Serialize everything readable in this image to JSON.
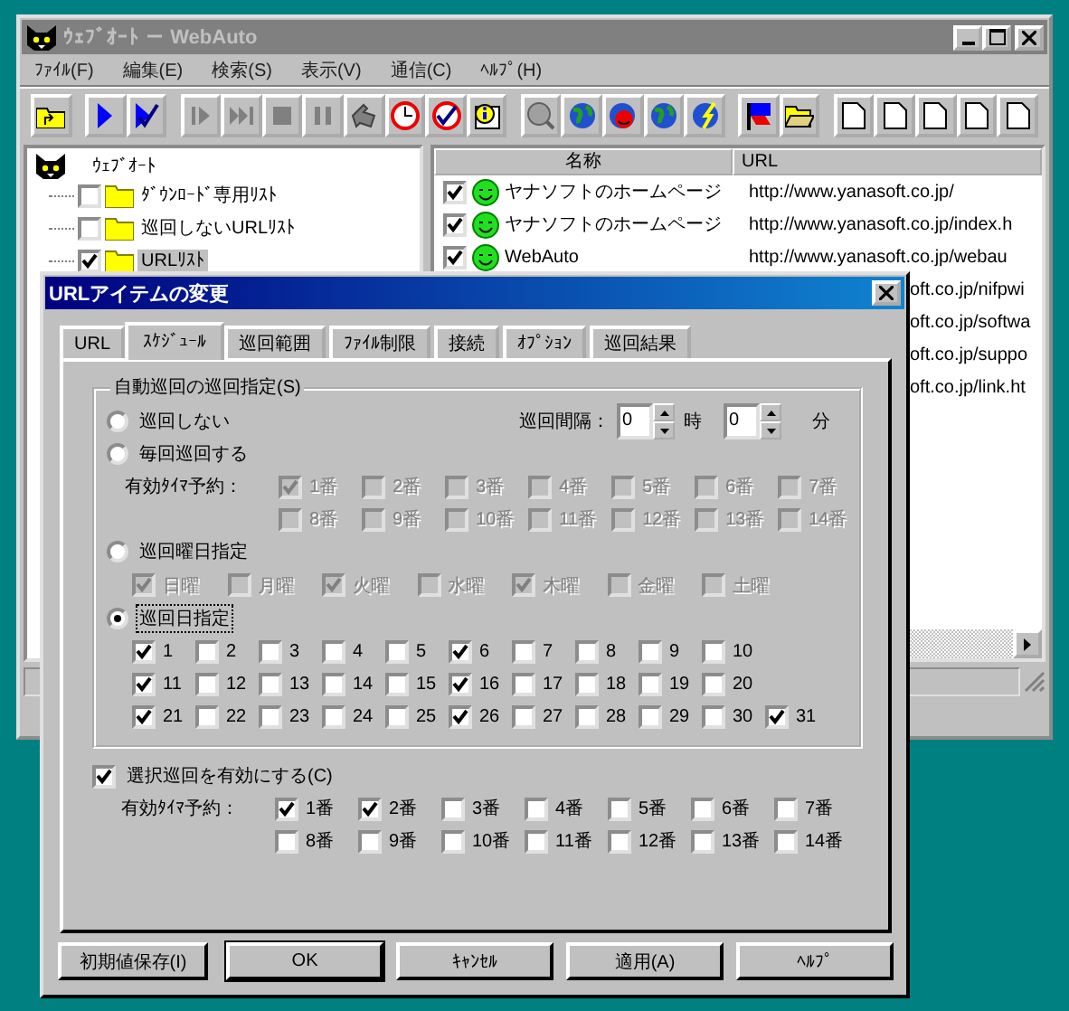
{
  "window": {
    "title": "ｳｪﾌﾞｵｰﾄ － WebAuto",
    "menu": [
      "ﾌｧｲﾙ(F)",
      "編集(E)",
      "検索(S)",
      "表示(V)",
      "通信(C)",
      "ﾍﾙﾌﾟ(H)"
    ]
  },
  "tree": {
    "label": "ｳｪﾌﾞｵｰﾄ",
    "children": [
      {
        "label": "ﾀﾞｳﾝﾛｰﾄﾞ専用ﾘｽﾄ",
        "checked": false,
        "selected": false
      },
      {
        "label": "巡回しないURLﾘｽﾄ",
        "checked": false,
        "selected": false
      },
      {
        "label": "URLﾘｽﾄ",
        "checked": true,
        "selected": true
      }
    ]
  },
  "list": {
    "columns": [
      "名称",
      "URL"
    ],
    "rows": [
      {
        "kind": "item",
        "checked": true,
        "name": "ヤナソフトのホームページ",
        "url": "http://www.yanasoft.co.jp/"
      },
      {
        "kind": "item",
        "checked": true,
        "name": "ヤナソフトのホームページ",
        "url": "http://www.yanasoft.co.jp/index.h"
      },
      {
        "kind": "item",
        "checked": true,
        "name": "WebAuto",
        "url": "http://www.yanasoft.co.jp/webau"
      },
      {
        "kind": "clipped",
        "url": "oft.co.jp/nifpwi"
      },
      {
        "kind": "clipped",
        "url": "oft.co.jp/softwa"
      },
      {
        "kind": "clipped",
        "url": "oft.co.jp/suppo"
      },
      {
        "kind": "clipped",
        "url": "oft.co.jp/link.ht"
      }
    ]
  },
  "dialog": {
    "title": "URLアイテムの変更",
    "tabs": [
      {
        "label": "URL",
        "selected": false
      },
      {
        "label": "ｽｹｼﾞｭｰﾙ",
        "selected": true
      },
      {
        "label": "巡回範囲",
        "selected": false
      },
      {
        "label": "ﾌｧｲﾙ制限",
        "selected": false
      },
      {
        "label": "接続",
        "selected": false
      },
      {
        "label": "ｵﾌﾟｼｮﾝ",
        "selected": false
      },
      {
        "label": "巡回結果",
        "selected": false
      }
    ],
    "schedule": {
      "title": "自動巡回の巡回指定(S)",
      "interval": {
        "label": "巡回間隔：",
        "hours": "0",
        "hours_unit": "時",
        "minutes": "0",
        "minutes_unit": "分"
      },
      "options": [
        {
          "kind": "none",
          "label": "巡回しない",
          "selected": false,
          "focused": false
        },
        {
          "kind": "timers",
          "label": "毎回巡回する",
          "selected": false,
          "focused": false,
          "disabled": true,
          "timers_label": "有効ﾀｲﾏ予約：",
          "items": [
            {
              "label": "1番",
              "checked": true
            },
            {
              "label": "2番",
              "checked": false
            },
            {
              "label": "3番",
              "checked": false
            },
            {
              "label": "4番",
              "checked": false
            },
            {
              "label": "5番",
              "checked": false
            },
            {
              "label": "6番",
              "checked": false
            },
            {
              "label": "7番",
              "checked": false
            },
            {
              "label": "8番",
              "checked": false
            },
            {
              "label": "9番",
              "checked": false
            },
            {
              "label": "10番",
              "checked": false
            },
            {
              "label": "11番",
              "checked": false
            },
            {
              "label": "12番",
              "checked": false
            },
            {
              "label": "13番",
              "checked": false
            },
            {
              "label": "14番",
              "checked": false
            }
          ]
        },
        {
          "kind": "weekdays",
          "label": "巡回曜日指定",
          "selected": false,
          "focused": false,
          "disabled": true,
          "items": [
            {
              "label": "日曜",
              "checked": true
            },
            {
              "label": "月曜",
              "checked": false
            },
            {
              "label": "火曜",
              "checked": true
            },
            {
              "label": "水曜",
              "checked": false
            },
            {
              "label": "木曜",
              "checked": true
            },
            {
              "label": "金曜",
              "checked": false
            },
            {
              "label": "土曜",
              "checked": false
            }
          ]
        },
        {
          "kind": "dates",
          "label": "巡回日指定",
          "selected": true,
          "focused": true,
          "disabled": false,
          "items": [
            {
              "label": "1",
              "checked": true
            },
            {
              "label": "2",
              "checked": false
            },
            {
              "label": "3",
              "checked": false
            },
            {
              "label": "4",
              "checked": false
            },
            {
              "label": "5",
              "checked": false
            },
            {
              "label": "6",
              "checked": true
            },
            {
              "label": "7",
              "checked": false
            },
            {
              "label": "8",
              "checked": false
            },
            {
              "label": "9",
              "checked": false
            },
            {
              "label": "10",
              "checked": false
            },
            {
              "label": "11",
              "checked": true
            },
            {
              "label": "12",
              "checked": false
            },
            {
              "label": "13",
              "checked": false
            },
            {
              "label": "14",
              "checked": false
            },
            {
              "label": "15",
              "checked": false
            },
            {
              "label": "16",
              "checked": true
            },
            {
              "label": "17",
              "checked": false
            },
            {
              "label": "18",
              "checked": false
            },
            {
              "label": "19",
              "checked": false
            },
            {
              "label": "20",
              "checked": false
            },
            {
              "label": "21",
              "checked": true
            },
            {
              "label": "22",
              "checked": false
            },
            {
              "label": "23",
              "checked": false
            },
            {
              "label": "24",
              "checked": false
            },
            {
              "label": "25",
              "checked": false
            },
            {
              "label": "26",
              "checked": true
            },
            {
              "label": "27",
              "checked": false
            },
            {
              "label": "28",
              "checked": false
            },
            {
              "label": "29",
              "checked": false
            },
            {
              "label": "30",
              "checked": false
            },
            {
              "label": "31",
              "checked": true
            }
          ]
        }
      ]
    },
    "selective": {
      "label": "選択巡回を有効にする(C)",
      "checked": true,
      "timers_label": "有効ﾀｲﾏ予約：",
      "items": [
        {
          "label": "1番",
          "checked": true
        },
        {
          "label": "2番",
          "checked": true
        },
        {
          "label": "3番",
          "checked": false
        },
        {
          "label": "4番",
          "checked": false
        },
        {
          "label": "5番",
          "checked": false
        },
        {
          "label": "6番",
          "checked": false
        },
        {
          "label": "7番",
          "checked": false
        },
        {
          "label": "8番",
          "checked": false
        },
        {
          "label": "9番",
          "checked": false
        },
        {
          "label": "10番",
          "checked": false
        },
        {
          "label": "11番",
          "checked": false
        },
        {
          "label": "12番",
          "checked": false
        },
        {
          "label": "13番",
          "checked": false
        },
        {
          "label": "14番",
          "checked": false
        }
      ]
    },
    "buttons": [
      {
        "label": "初期値保存(I)",
        "default": false
      },
      {
        "label": "OK",
        "default": true
      },
      {
        "label": "ｷｬﾝｾﾙ",
        "default": false
      },
      {
        "label": "適用(A)",
        "default": false
      },
      {
        "label": "ﾍﾙﾌﾟ",
        "default": false
      }
    ]
  }
}
